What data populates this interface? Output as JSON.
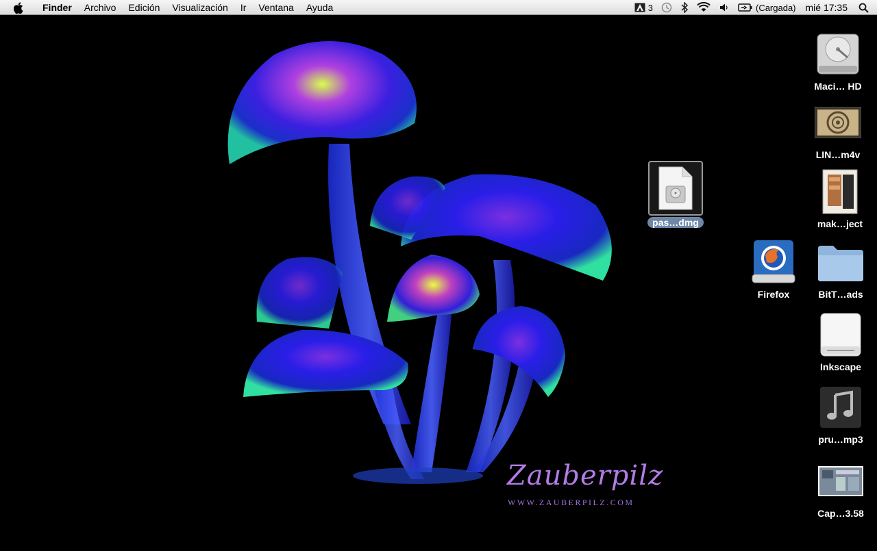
{
  "menubar": {
    "app_name": "Finder",
    "items": [
      "Archivo",
      "Edición",
      "Visualización",
      "Ir",
      "Ventana",
      "Ayuda"
    ],
    "status": {
      "adobe_count": "3",
      "battery_text": "(Cargada)",
      "clock": "mié 17:35"
    }
  },
  "wallpaper": {
    "title": "Zauberpilz",
    "url": "WWW.ZAUBERPILZ.COM"
  },
  "desktop": {
    "selected_file": {
      "label": "pas…dmg",
      "icon": "disk-image-file-icon"
    },
    "firefox": {
      "label": "Firefox",
      "icon": "firefox-drive-icon"
    },
    "icons": [
      {
        "label": "Maci… HD",
        "icon": "hard-drive-icon"
      },
      {
        "label": "LIN…m4v",
        "icon": "video-thumbnail-icon"
      },
      {
        "label": "mak…ject",
        "icon": "project-document-icon"
      },
      {
        "label": "BitT…ads",
        "icon": "folder-icon"
      },
      {
        "label": "Inkscape",
        "icon": "removable-drive-icon"
      },
      {
        "label": "pru…mp3",
        "icon": "music-file-icon"
      },
      {
        "label": "Cap…3.58",
        "icon": "screenshot-thumbnail-icon"
      }
    ]
  },
  "colors": {
    "wallpaper_bg": "#000000",
    "title_purple": "#b27ce6",
    "selection_label": "#6e87a8"
  }
}
